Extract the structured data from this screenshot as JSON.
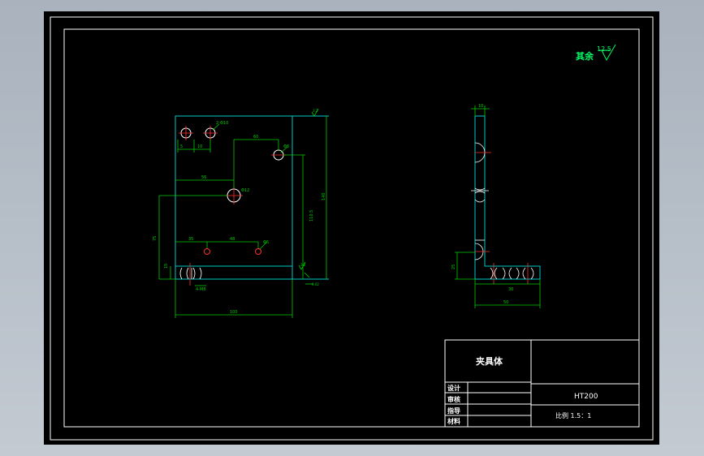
{
  "drawing": {
    "roughness_symbol": {
      "prefix": "其余",
      "value": "12.5"
    },
    "title_block": {
      "part_name": "夹具体",
      "material_code": "HT200",
      "scale_text": "比例 1.5：1",
      "rows": [
        "设计",
        "审核",
        "指导",
        "材料"
      ]
    },
    "front_view": {
      "dims": {
        "d_hole1": "2-Φ10",
        "d_hole_right": "Φ8",
        "d_hole_center": "Φ12",
        "d_small": "Φ6",
        "d_bottom": "4-M8",
        "w_top": "5",
        "w_top2": "10",
        "len_a": "60",
        "len_b": "56",
        "len_c": "35",
        "len_d": "48",
        "len_e": "78",
        "h_total": "140",
        "h_mid": "110.5",
        "h_left": "75",
        "h_small": "15",
        "w_total": "100",
        "rough_top": "3.2",
        "rough_bottom": "3.2",
        "tol": "0.02"
      }
    },
    "side_view": {
      "dims": {
        "top": "10",
        "bottom": "50",
        "side": "25",
        "mid": "30"
      }
    }
  },
  "colors": {
    "background": "#000000",
    "frame": "#ffffff",
    "part_line": "#00c8c8",
    "dim_line": "#00cc00",
    "center_line": "#ff3030",
    "text": "#ffffff",
    "symbol": "#00ff66"
  }
}
